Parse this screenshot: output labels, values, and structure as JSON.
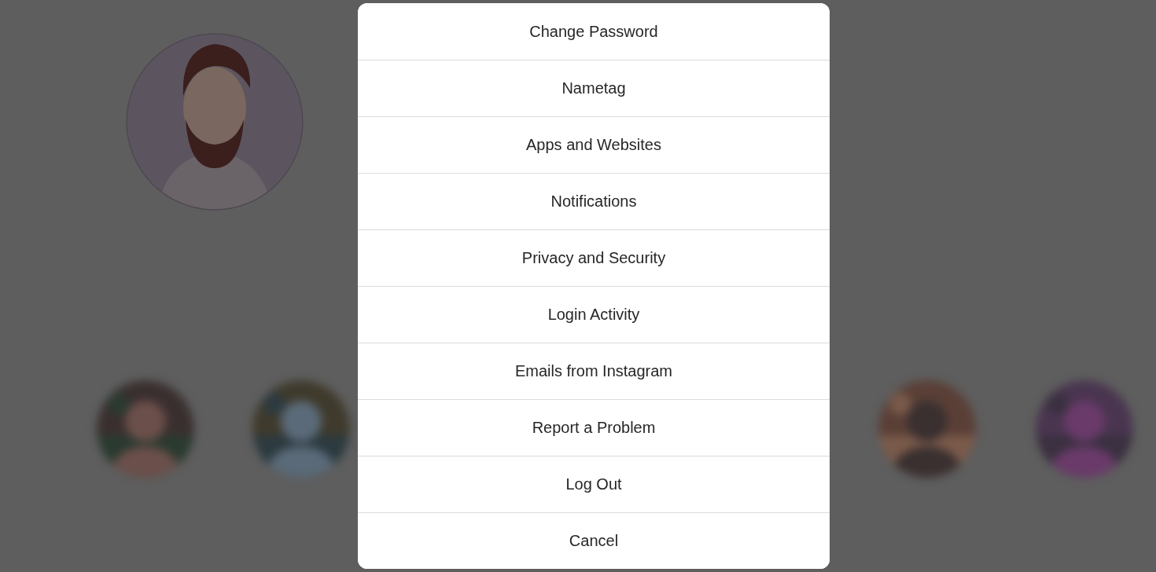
{
  "menu": {
    "items": [
      {
        "label": "Change Password"
      },
      {
        "label": "Nametag"
      },
      {
        "label": "Apps and Websites"
      },
      {
        "label": "Notifications"
      },
      {
        "label": "Privacy and Security"
      },
      {
        "label": "Login Activity"
      },
      {
        "label": "Emails from Instagram"
      },
      {
        "label": "Report a Problem"
      },
      {
        "label": "Log Out"
      },
      {
        "label": "Cancel"
      }
    ]
  }
}
